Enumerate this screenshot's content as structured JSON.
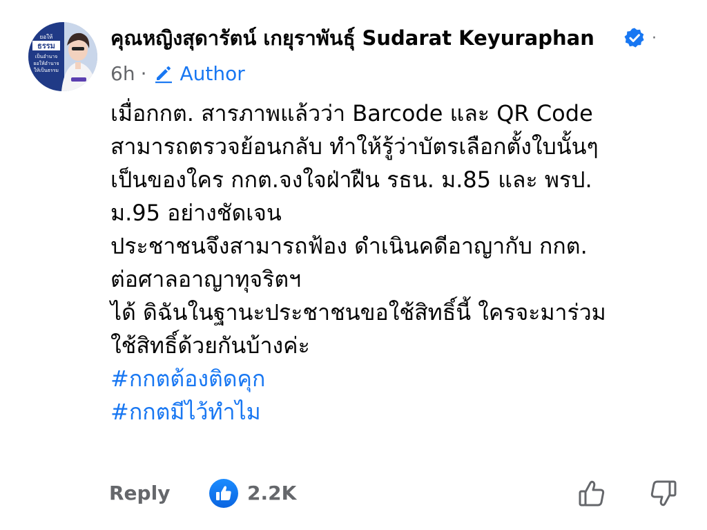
{
  "comment": {
    "author": {
      "name": "คุณหญิงสุดารัตน์ เกยุราพันธุ์ Sudarat Keyuraphan",
      "verified": true,
      "avatar_text": [
        "ยอให้",
        "ธรรม",
        "เป็นอำนาจ",
        "ยอให้อำนาจ",
        "ให้เป็นธรรม"
      ]
    },
    "more_glyph": "·",
    "meta": {
      "time": "6h",
      "separator": "·",
      "badge_label": "Author"
    },
    "body_lines": [
      "เมื่อกกต. สารภาพแล้วว่า Barcode และ QR Code",
      "สามารถตรวจย้อนกลับ ทำให้รู้ว่าบัตรเลือกตั้งใบนั้นๆ",
      "เป็นของใคร  กกต.จงใจฝ่าฝืน รธน. ม.85 และ พรป.",
      "ม.95 อย่างชัดเจน",
      "ประชาชนจึงสามารถฟ้อง ดำเนินคดีอาญากับ กกต.",
      "ต่อศาลอาญาทุจริตฯ",
      "ได้  ดิฉันในฐานะประชาชนขอใช้สิทธิ์นี้ ใครจะมาร่วม",
      "ใช้สิทธิ์ด้วยกันบ้างค่ะ"
    ],
    "hashtags": [
      "#กกตต้องติดคุก",
      "#กกตมีไว้ทำไม"
    ],
    "actions": {
      "reply_label": "Reply",
      "like_count": "2.2K"
    },
    "colors": {
      "link_blue": "#1877f2",
      "secondary_gray": "#65676b",
      "text_black": "#050505"
    },
    "icons": {
      "verified": "verified-badge-icon",
      "author_badge": "pencil-icon",
      "like_reaction": "like-reaction-icon",
      "thumb_up": "thumbs-up-icon",
      "thumb_down": "thumbs-down-icon"
    }
  }
}
